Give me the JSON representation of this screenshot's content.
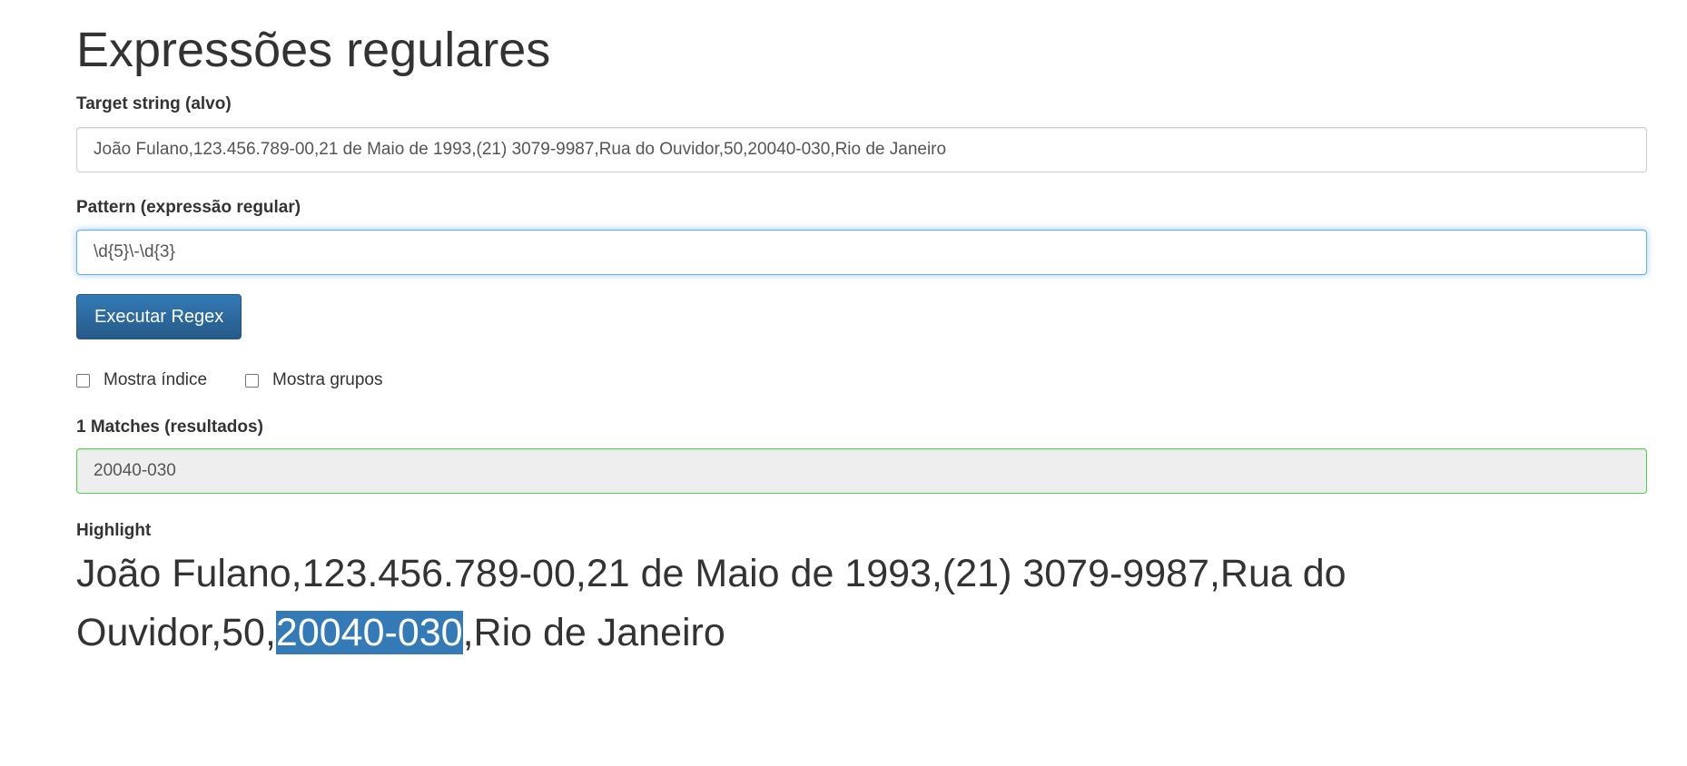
{
  "page": {
    "title": "Expressões regulares"
  },
  "target": {
    "label": "Target string (alvo)",
    "value": "João Fulano,123.456.789-00,21 de Maio de 1993,(21) 3079-9987,Rua do Ouvidor,50,20040-030,Rio de Janeiro"
  },
  "pattern": {
    "label": "Pattern (expressão regular)",
    "value": "\\d{5}\\-\\d{3}"
  },
  "execute_button": {
    "label": "Executar Regex"
  },
  "options": {
    "show_index": {
      "label": "Mostra índice",
      "checked": false
    },
    "show_groups": {
      "label": "Mostra grupos",
      "checked": false
    }
  },
  "matches": {
    "label": "1 Matches (resultados)",
    "value": "20040-030"
  },
  "highlight": {
    "label": "Highlight",
    "before": "João Fulano,123.456.789-00,21 de Maio de 1993,(21) 3079-9987,Rua do Ouvidor,50,",
    "match": "20040-030",
    "after": ",Rio de Janeiro"
  },
  "colors": {
    "primary": "#337ab7",
    "focus_border": "#66afe9",
    "success_border": "#4cd24c",
    "highlight_bg": "#337ab7"
  }
}
